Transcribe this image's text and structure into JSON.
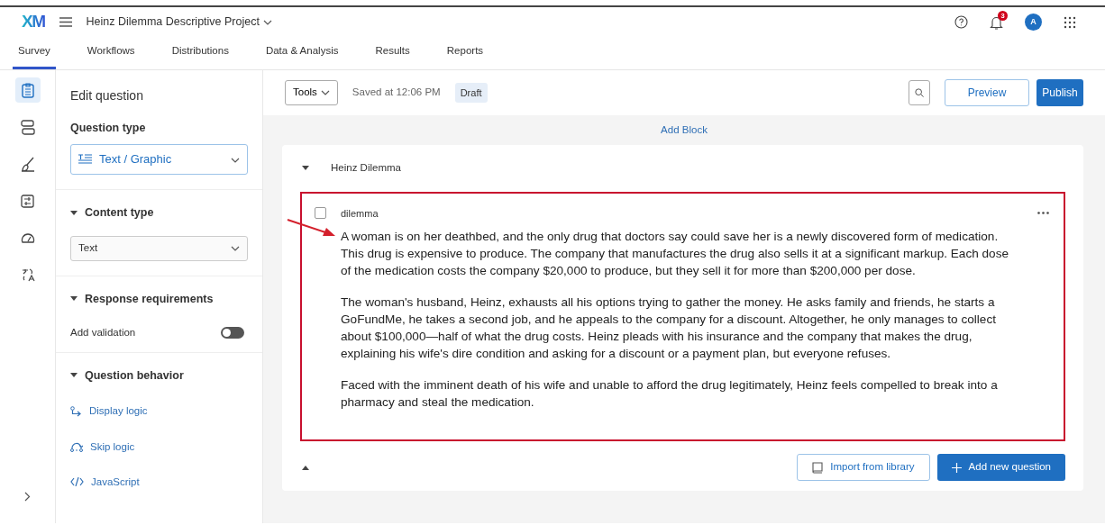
{
  "header": {
    "logo": "XM",
    "project_title": "Heinz Dilemma Descriptive Project",
    "notification_count": "3",
    "avatar_initial": "A"
  },
  "tabs": [
    {
      "label": "Survey",
      "selected": true
    },
    {
      "label": "Workflows",
      "selected": false
    },
    {
      "label": "Distributions",
      "selected": false
    },
    {
      "label": "Data & Analysis",
      "selected": false
    },
    {
      "label": "Results",
      "selected": false
    },
    {
      "label": "Reports",
      "selected": false
    }
  ],
  "rail": [
    {
      "kind": "survey",
      "selected": true
    },
    {
      "kind": "blocks",
      "selected": false
    },
    {
      "kind": "style",
      "selected": false
    },
    {
      "kind": "options",
      "selected": false
    },
    {
      "kind": "meter",
      "selected": false
    },
    {
      "kind": "translate",
      "selected": false
    }
  ],
  "panel": {
    "title": "Edit question",
    "question_type_label": "Question type",
    "question_type_value": "Text / Graphic",
    "content_type_label": "Content type",
    "content_type_value": "Text",
    "response_label": "Response requirements",
    "validation_label": "Add validation",
    "validation_on": false,
    "behavior_label": "Question behavior",
    "behavior_links": [
      {
        "kind": "display",
        "label": "Display logic"
      },
      {
        "kind": "skip",
        "label": "Skip logic"
      },
      {
        "kind": "code",
        "label": "JavaScript"
      }
    ]
  },
  "toolbar": {
    "tools": "Tools",
    "saved": "Saved at 12:06 PM",
    "status": "Draft",
    "preview": "Preview",
    "publish": "Publish"
  },
  "add_block": "Add Block",
  "block": {
    "title": "Heinz Dilemma",
    "expanded": true,
    "question": {
      "label": "dilemma",
      "checked": false,
      "highlighted": true,
      "paragraphs": [
        "A woman is on her deathbed, and the only drug that doctors say could save her is a newly discovered form of medication. This drug is expensive to produce. The company that manufactures the drug also sells it at a significant markup. Each dose of the medication costs the company $20,000 to produce, but they sell it for more than $200,000 per dose.",
        "The woman's husband, Heinz, exhausts all his options trying to gather the money. He asks family and friends, he starts a GoFundMe, he takes a second job, and he appeals to the company for a discount. Altogether, he only manages to collect about $100,000—half of what the drug costs. Heinz pleads with his insurance and the company that makes the drug, explaining his wife's dire condition and asking for a discount or a payment plan, but everyone refuses.",
        "Faced with the imminent death of his wife and unable to afford the drug legitimately, Heinz feels compelled to break into a pharmacy and steal the medication."
      ]
    },
    "import_button": "Import from library",
    "add_question_button": "Add new question"
  }
}
